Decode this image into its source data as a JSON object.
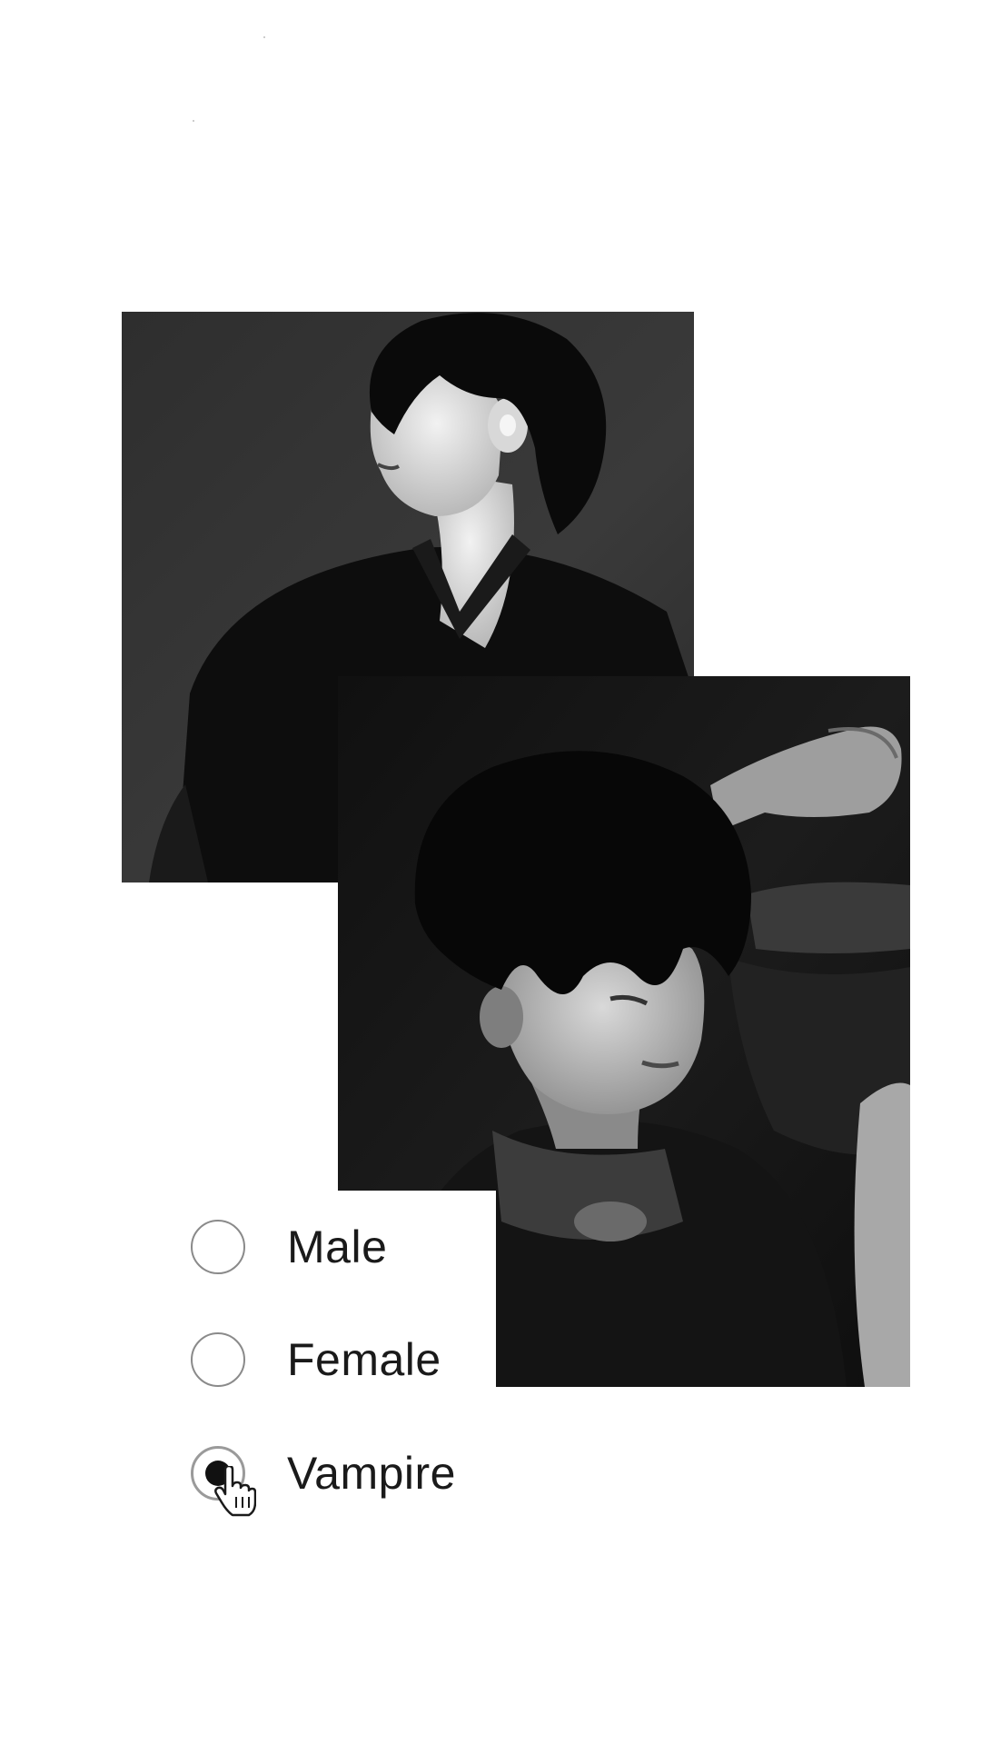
{
  "radio_group": {
    "options": [
      {
        "label": "Male",
        "checked": false
      },
      {
        "label": "Female",
        "checked": false
      },
      {
        "label": "Vampire",
        "checked": true
      }
    ]
  },
  "images": [
    {
      "description_name": "portrait-top",
      "style": "black-and-white"
    },
    {
      "description_name": "portrait-bottom",
      "style": "black-and-white"
    }
  ],
  "icons": {
    "cursor": "hand-pointer-icon"
  },
  "colors": {
    "background": "#ffffff",
    "text": "#1a1a1a",
    "radio_border": "#8a8a8a",
    "radio_dot": "#111111"
  }
}
